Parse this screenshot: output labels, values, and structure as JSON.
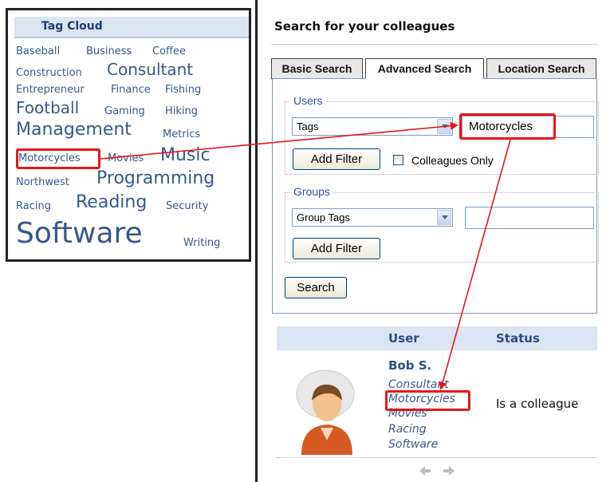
{
  "tag_cloud": {
    "title": "Tag Cloud",
    "tags": [
      {
        "label": "Baseball",
        "weight": 1
      },
      {
        "label": "Business",
        "weight": 1
      },
      {
        "label": "Coffee",
        "weight": 1
      },
      {
        "label": "Construction",
        "weight": 1
      },
      {
        "label": "Consultant",
        "weight": 3
      },
      {
        "label": "Entrepreneur",
        "weight": 1
      },
      {
        "label": "Finance",
        "weight": 1
      },
      {
        "label": "Fishing",
        "weight": 1
      },
      {
        "label": "Football",
        "weight": 3
      },
      {
        "label": "Gaming",
        "weight": 1
      },
      {
        "label": "Hiking",
        "weight": 1
      },
      {
        "label": "Management",
        "weight": 3
      },
      {
        "label": "Metrics",
        "weight": 1
      },
      {
        "label": "Motorcycles",
        "weight": 1
      },
      {
        "label": "Movies",
        "weight": 1
      },
      {
        "label": "Music",
        "weight": 3
      },
      {
        "label": "Northwest",
        "weight": 1
      },
      {
        "label": "Programming",
        "weight": 3
      },
      {
        "label": "Racing",
        "weight": 1
      },
      {
        "label": "Reading",
        "weight": 3
      },
      {
        "label": "Security",
        "weight": 1
      },
      {
        "label": "Software",
        "weight": 5
      },
      {
        "label": "Writing",
        "weight": 1
      }
    ]
  },
  "search": {
    "title": "Search for your colleagues",
    "tabs": [
      {
        "label": "Basic Search",
        "active": false
      },
      {
        "label": "Advanced Search",
        "active": true
      },
      {
        "label": "Location Search",
        "active": false
      }
    ],
    "users": {
      "legend": "Users",
      "select_value": "Tags",
      "input_value": "Motorcycles",
      "add_filter_label": "Add Filter",
      "colleagues_only_label": "Colleagues Only",
      "colleagues_only_checked": false
    },
    "groups": {
      "legend": "Groups",
      "select_value": "Group Tags",
      "input_value": "",
      "add_filter_label": "Add Filter"
    },
    "search_button_label": "Search"
  },
  "results": {
    "columns": [
      "User",
      "Status"
    ],
    "rows": [
      {
        "user_name": "Bob S.",
        "tags": [
          "Consultant",
          "Motorcycles",
          "Movies",
          "Racing",
          "Software"
        ],
        "status": "Is a colleague"
      }
    ]
  },
  "colors": {
    "highlight": "#e8141b",
    "tag_link": "#38578a",
    "header_band": "#dbe4f1"
  }
}
